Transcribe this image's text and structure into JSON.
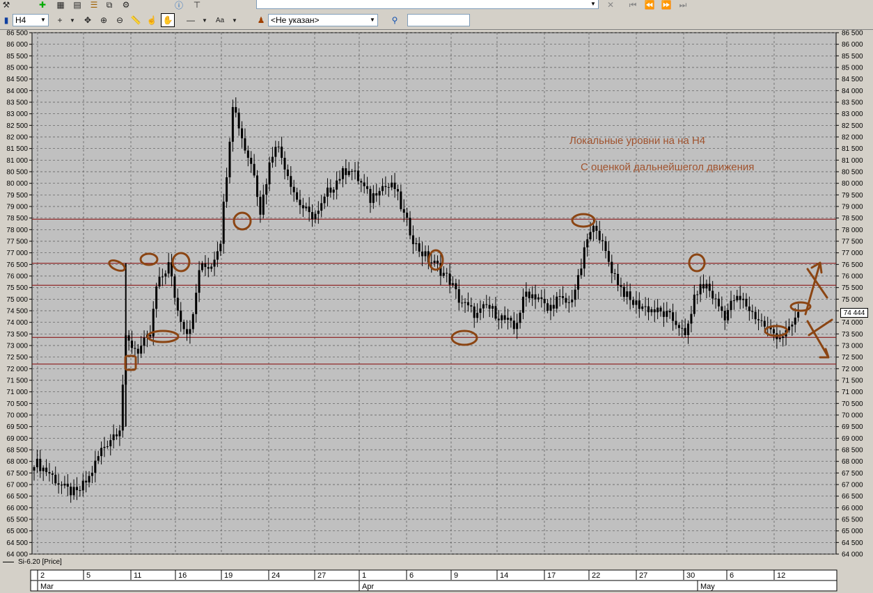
{
  "toolbar": {
    "timeframe": "H4",
    "account_select": "<Не указан>",
    "font_button": "Aa",
    "search_value": ""
  },
  "chart_data": {
    "type": "candlestick",
    "instrument_label": "Si-6.20 [Price]",
    "yrange": [
      64000,
      86500
    ],
    "ystep": 500,
    "y_tick_labels": [
      "86 500",
      "86 000",
      "85 500",
      "85 000",
      "84 500",
      "84 000",
      "83 500",
      "83 000",
      "82 500",
      "82 000",
      "81 500",
      "81 000",
      "80 500",
      "80 000",
      "79 500",
      "79 000",
      "78 500",
      "78 000",
      "77 500",
      "77 000",
      "76 500",
      "76 000",
      "75 500",
      "75 000",
      "74 500",
      "74 000",
      "73 500",
      "73 000",
      "72 500",
      "72 000",
      "71 500",
      "71 000",
      "70 500",
      "70 000",
      "69 500",
      "69 000",
      "68 500",
      "68 000",
      "67 500",
      "67 000",
      "66 500",
      "66 000",
      "65 500",
      "65 000",
      "64 500",
      "64 000"
    ],
    "x_day_labels": [
      "2",
      "5",
      "11",
      "16",
      "19",
      "24",
      "27",
      "1",
      "6",
      "9",
      "14",
      "17",
      "22",
      "27",
      "30",
      "6",
      "12"
    ],
    "x_month_labels": [
      "Mar",
      "Apr",
      "May"
    ],
    "last_price_label": "74 444",
    "last_price": 74444,
    "horizontal_levels": [
      78450,
      76550,
      75600,
      73350,
      72200
    ],
    "annotations": [
      "Локальные уровни на на Н4",
      "С оценкой дальнейшегол движения"
    ],
    "path_keyframes": [
      [
        0,
        68000
      ],
      [
        5,
        67500
      ],
      [
        10,
        66800
      ],
      [
        14,
        66600
      ],
      [
        18,
        67300
      ],
      [
        22,
        68500
      ],
      [
        28,
        69500
      ],
      [
        30,
        73200
      ],
      [
        34,
        72800
      ],
      [
        38,
        73400
      ],
      [
        40,
        75500
      ],
      [
        44,
        76500
      ],
      [
        47,
        74500
      ],
      [
        50,
        73600
      ],
      [
        52,
        74200
      ],
      [
        54,
        76300
      ],
      [
        58,
        76500
      ],
      [
        61,
        77600
      ],
      [
        63,
        80500
      ],
      [
        65,
        83500
      ],
      [
        69,
        81500
      ],
      [
        72,
        80500
      ],
      [
        74,
        78800
      ],
      [
        77,
        80800
      ],
      [
        79,
        81800
      ],
      [
        82,
        80800
      ],
      [
        86,
        79300
      ],
      [
        90,
        78600
      ],
      [
        93,
        78700
      ],
      [
        96,
        79600
      ],
      [
        100,
        80300
      ],
      [
        103,
        80700
      ],
      [
        107,
        80000
      ],
      [
        110,
        79300
      ],
      [
        113,
        79900
      ],
      [
        118,
        79800
      ],
      [
        121,
        78600
      ],
      [
        125,
        77300
      ],
      [
        129,
        76700
      ],
      [
        132,
        76400
      ],
      [
        136,
        75800
      ],
      [
        139,
        75000
      ],
      [
        142,
        74600
      ],
      [
        145,
        74300
      ],
      [
        148,
        74700
      ],
      [
        152,
        74300
      ],
      [
        155,
        74000
      ],
      [
        157,
        73700
      ],
      [
        161,
        75300
      ],
      [
        165,
        75100
      ],
      [
        168,
        74500
      ],
      [
        171,
        75000
      ],
      [
        175,
        74800
      ],
      [
        178,
        75800
      ],
      [
        181,
        77600
      ],
      [
        184,
        78200
      ],
      [
        186,
        77300
      ],
      [
        189,
        76300
      ],
      [
        192,
        75500
      ],
      [
        195,
        74900
      ],
      [
        199,
        74700
      ],
      [
        203,
        74500
      ],
      [
        207,
        74300
      ],
      [
        211,
        73900
      ],
      [
        213,
        73300
      ],
      [
        215,
        74500
      ],
      [
        217,
        75400
      ],
      [
        220,
        75600
      ],
      [
        223,
        74900
      ],
      [
        226,
        74300
      ],
      [
        229,
        75000
      ],
      [
        232,
        74900
      ],
      [
        235,
        74400
      ],
      [
        238,
        74000
      ],
      [
        241,
        73600
      ],
      [
        244,
        73400
      ],
      [
        247,
        73600
      ],
      [
        250,
        74444
      ]
    ]
  }
}
